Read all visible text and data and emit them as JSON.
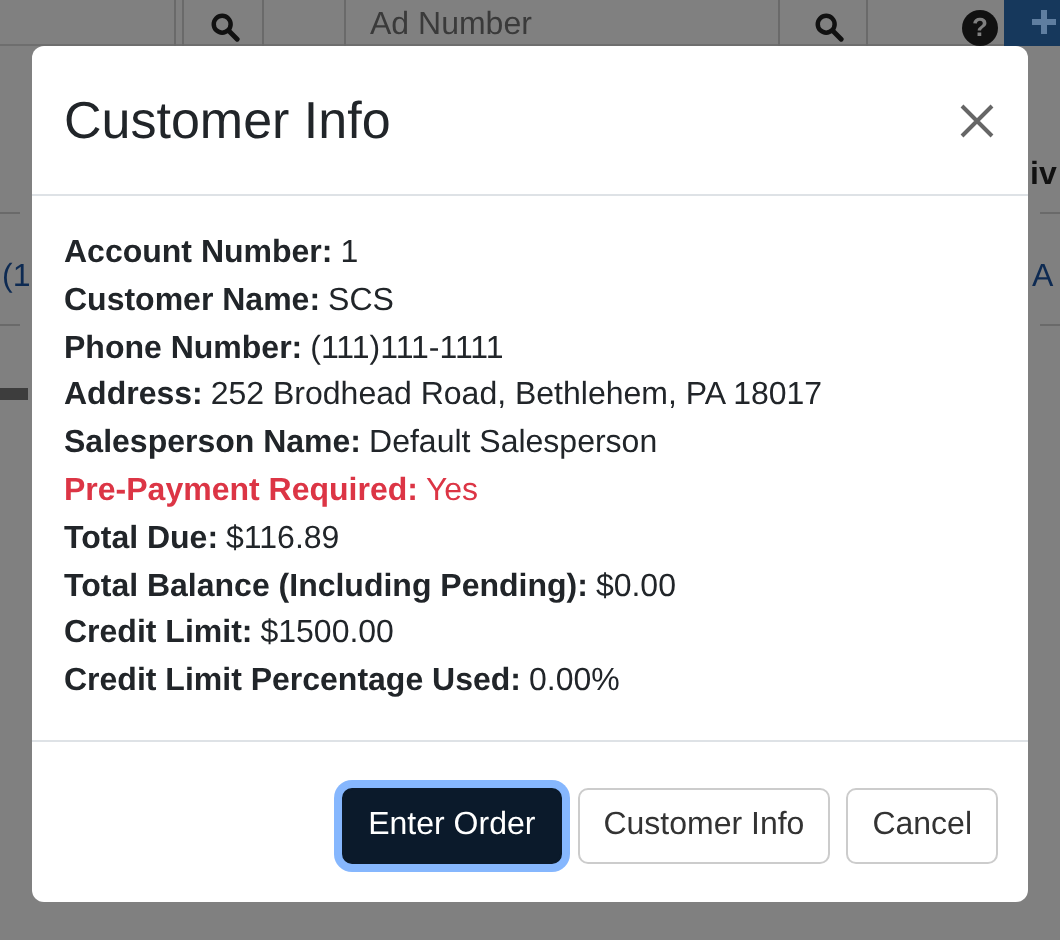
{
  "background": {
    "search_field": {
      "placeholder": "Ad Number"
    },
    "help_glyph": "?",
    "row_text_left": "(1",
    "header_text_right": "iv",
    "row_text_right": "A"
  },
  "modal": {
    "title": "Customer Info",
    "fields": [
      {
        "label": "Account Number:",
        "value": "1",
        "kind": "normal"
      },
      {
        "label": "Customer Name:",
        "value": "SCS",
        "kind": "normal"
      },
      {
        "label": "Phone Number:",
        "value": "(111)111-1111",
        "kind": "normal"
      },
      {
        "label": "Address:",
        "value": "252 Brodhead Road, Bethlehem, PA 18017",
        "kind": "normal"
      },
      {
        "label": "Salesperson Name:",
        "value": "Default Salesperson",
        "kind": "normal"
      },
      {
        "label": "Pre-Payment Required:",
        "value": "Yes",
        "kind": "alert"
      },
      {
        "label": "Total Due:",
        "value": "$116.89",
        "kind": "normal"
      },
      {
        "label": "Total Balance (Including Pending):",
        "value": "$0.00",
        "kind": "normal"
      },
      {
        "label": "Credit Limit:",
        "value": "$1500.00",
        "kind": "normal"
      },
      {
        "label": "Credit Limit Percentage Used:",
        "value": "0.00%",
        "kind": "normal"
      }
    ],
    "buttons": [
      {
        "label": "Enter Order",
        "kind": "primary",
        "focused": true
      },
      {
        "label": "Customer Info",
        "kind": "secondary",
        "focused": false
      },
      {
        "label": "Cancel",
        "kind": "secondary",
        "focused": false
      }
    ]
  }
}
